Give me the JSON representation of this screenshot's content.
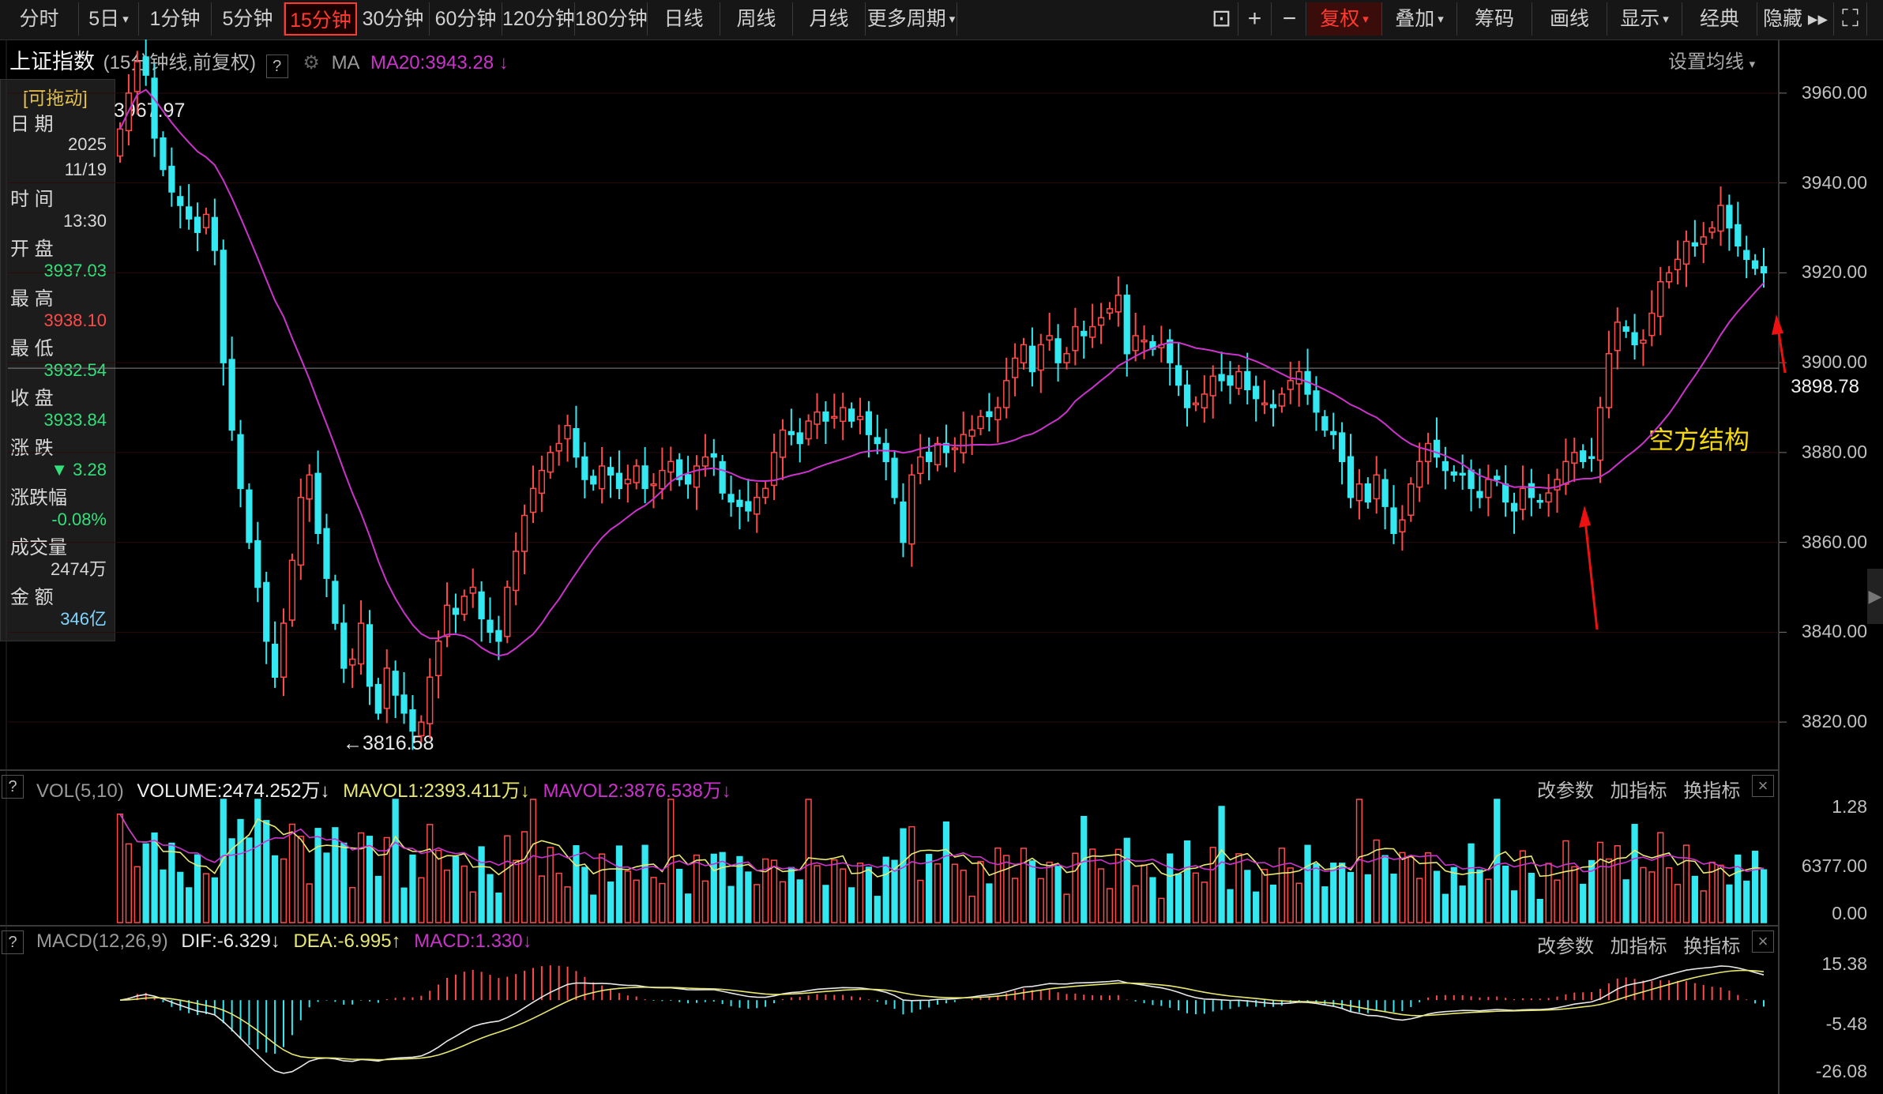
{
  "toolbar": {
    "tabs": [
      {
        "label": "分时"
      },
      {
        "label": "5日",
        "caret": "▾"
      },
      {
        "label": "1分钟"
      },
      {
        "label": "5分钟"
      },
      {
        "label": "15分钟",
        "active": true
      },
      {
        "label": "30分钟"
      },
      {
        "label": "60分钟"
      },
      {
        "label": "120分钟"
      },
      {
        "label": "180分钟"
      },
      {
        "label": "日线"
      },
      {
        "label": "周线"
      },
      {
        "label": "月线"
      },
      {
        "label": "更多周期",
        "caret": "▾"
      }
    ],
    "right_buttons": [
      {
        "label": "复权",
        "caret": "▾",
        "highlight": true
      },
      {
        "label": "叠加",
        "caret": "▾"
      },
      {
        "label": "筹码"
      },
      {
        "label": "画线"
      },
      {
        "label": "显示",
        "caret": "▾"
      },
      {
        "label": "经典"
      },
      {
        "label": "隐藏 ▸▸"
      }
    ],
    "icons": [
      "lock-icon",
      "zoom-in-icon",
      "zoom-out-icon",
      "expand-icon"
    ]
  },
  "chart_header": {
    "title": "上证指数",
    "subtitle": "(15分钟线,前复权)",
    "help": "?",
    "ma_label": "MA",
    "ma20": "MA20:3943.28",
    "ma20_arrow": "↓",
    "settings_link": "设置均线",
    "settings_caret": "▾"
  },
  "info_panel": {
    "drag_label": "[可拖动]",
    "rows": [
      {
        "label": "日 期",
        "value": "2025\n11/19",
        "color": "#d8d8d8"
      },
      {
        "label": "时 间",
        "value": "13:30",
        "color": "#d8d8d8"
      },
      {
        "label": "开 盘",
        "value": "3937.03",
        "color": "#33e07a"
      },
      {
        "label": "最 高",
        "value": "3938.10",
        "color": "#ff4a4a"
      },
      {
        "label": "最 低",
        "value": "3932.54",
        "color": "#33e07a"
      },
      {
        "label": "收 盘",
        "value": "3933.84",
        "color": "#33e07a"
      },
      {
        "label": "涨 跌",
        "value": "▼ 3.28",
        "color": "#33e07a"
      },
      {
        "label": "涨跌幅",
        "value": "-0.08%",
        "color": "#33e07a"
      },
      {
        "label": "成交量",
        "value": "2474万",
        "color": "#d8d8d8"
      },
      {
        "label": "金 额",
        "value": "346亿",
        "color": "#7fd5ff"
      }
    ]
  },
  "price_axis": [
    "3960.00",
    "3940.00",
    "3920.00",
    "3900.00",
    "3880.00",
    "3860.00",
    "3840.00",
    "3820.00"
  ],
  "price_markers": {
    "high": "3967.97",
    "low": "3816.58",
    "low_arrow": "←3816.58",
    "current": "3898.78"
  },
  "annotation": {
    "text": "空方结构",
    "color": "#f5d90a"
  },
  "volume_panel": {
    "label": "VOL(5,10)",
    "volume": "VOLUME:2474.252万",
    "mavol1": "MAVOL1:2393.411万",
    "mavol2": "MAVOL2:3876.538万",
    "arrow": "↓",
    "axis": [
      "1.28",
      "6377.00",
      "0.00"
    ],
    "links": [
      "改参数",
      "加指标",
      "换指标"
    ],
    "close": "×"
  },
  "macd_panel": {
    "label": "MACD(12,26,9)",
    "dif": "DIF:-6.329",
    "dea": "DEA:-6.995",
    "macd": "MACD:1.330",
    "dif_arrow": "↓",
    "dea_arrow": "↑",
    "macd_arrow": "↓",
    "axis": [
      "15.38",
      "-5.48",
      "-26.08"
    ],
    "links": [
      "改参数",
      "加指标",
      "换指标"
    ],
    "close": "×"
  },
  "colors": {
    "up": "#ff4a4a",
    "down": "#33e8f0",
    "ma": "#cc33cc",
    "mavol1": "#e8e870",
    "mavol2": "#cc33cc",
    "dif": "#e8e8e8",
    "dea": "#e8e870",
    "accent": "#ff3b2f",
    "grid": "#2a0b0b"
  },
  "chart_data": {
    "type": "candlestick",
    "interval": "15min",
    "ylim": [
      3810,
      3970
    ],
    "close": [
      3952,
      3960,
      3967,
      3964,
      3950,
      3943,
      3938,
      3935,
      3932,
      3929,
      3933,
      3925,
      3900,
      3885,
      3872,
      3860,
      3850,
      3838,
      3830,
      3842,
      3856,
      3870,
      3875,
      3862,
      3852,
      3842,
      3832,
      3834,
      3842,
      3828,
      3822,
      3832,
      3826,
      3822,
      3818,
      3820,
      3830,
      3838,
      3846,
      3844,
      3848,
      3850,
      3843,
      3840,
      3838,
      3850,
      3858,
      3866,
      3872,
      3876,
      3880,
      3882,
      3886,
      3879,
      3874,
      3873,
      3877,
      3875,
      3872,
      3874,
      3877,
      3872,
      3873,
      3876,
      3878,
      3874,
      3873,
      3877,
      3879,
      3879,
      3871,
      3869,
      3868,
      3867,
      3870,
      3872,
      3880,
      3885,
      3884,
      3882,
      3887,
      3889,
      3887,
      3888,
      3890,
      3887,
      3888,
      3884,
      3882,
      3878,
      3870,
      3860,
      3875,
      3879,
      3878,
      3882,
      3880,
      3881,
      3884,
      3885,
      3888,
      3888,
      3890,
      3896,
      3901,
      3904,
      3898,
      3904,
      3906,
      3900,
      3902,
      3908,
      3906,
      3908,
      3910,
      3912,
      3915,
      3902,
      3906,
      3905,
      3903,
      3904,
      3900,
      3895,
      3890,
      3891,
      3893,
      3897,
      3896,
      3895,
      3898,
      3894,
      3892,
      3891,
      3890,
      3893,
      3896,
      3898,
      3893,
      3889,
      3885,
      3884,
      3878,
      3870,
      3873,
      3869,
      3875,
      3868,
      3862,
      3865,
      3873,
      3878,
      3882,
      3879,
      3876,
      3875,
      3875,
      3872,
      3870,
      3874,
      3874,
      3869,
      3867,
      3872,
      3870,
      3869,
      3871,
      3874,
      3878,
      3880,
      3878,
      3879,
      3890,
      3902,
      3909,
      3907,
      3904,
      3905,
      3911,
      3918,
      3920,
      3923,
      3927,
      3926,
      3928,
      3930,
      3935,
      3930,
      3926,
      3923,
      3921,
      3920
    ]
  }
}
